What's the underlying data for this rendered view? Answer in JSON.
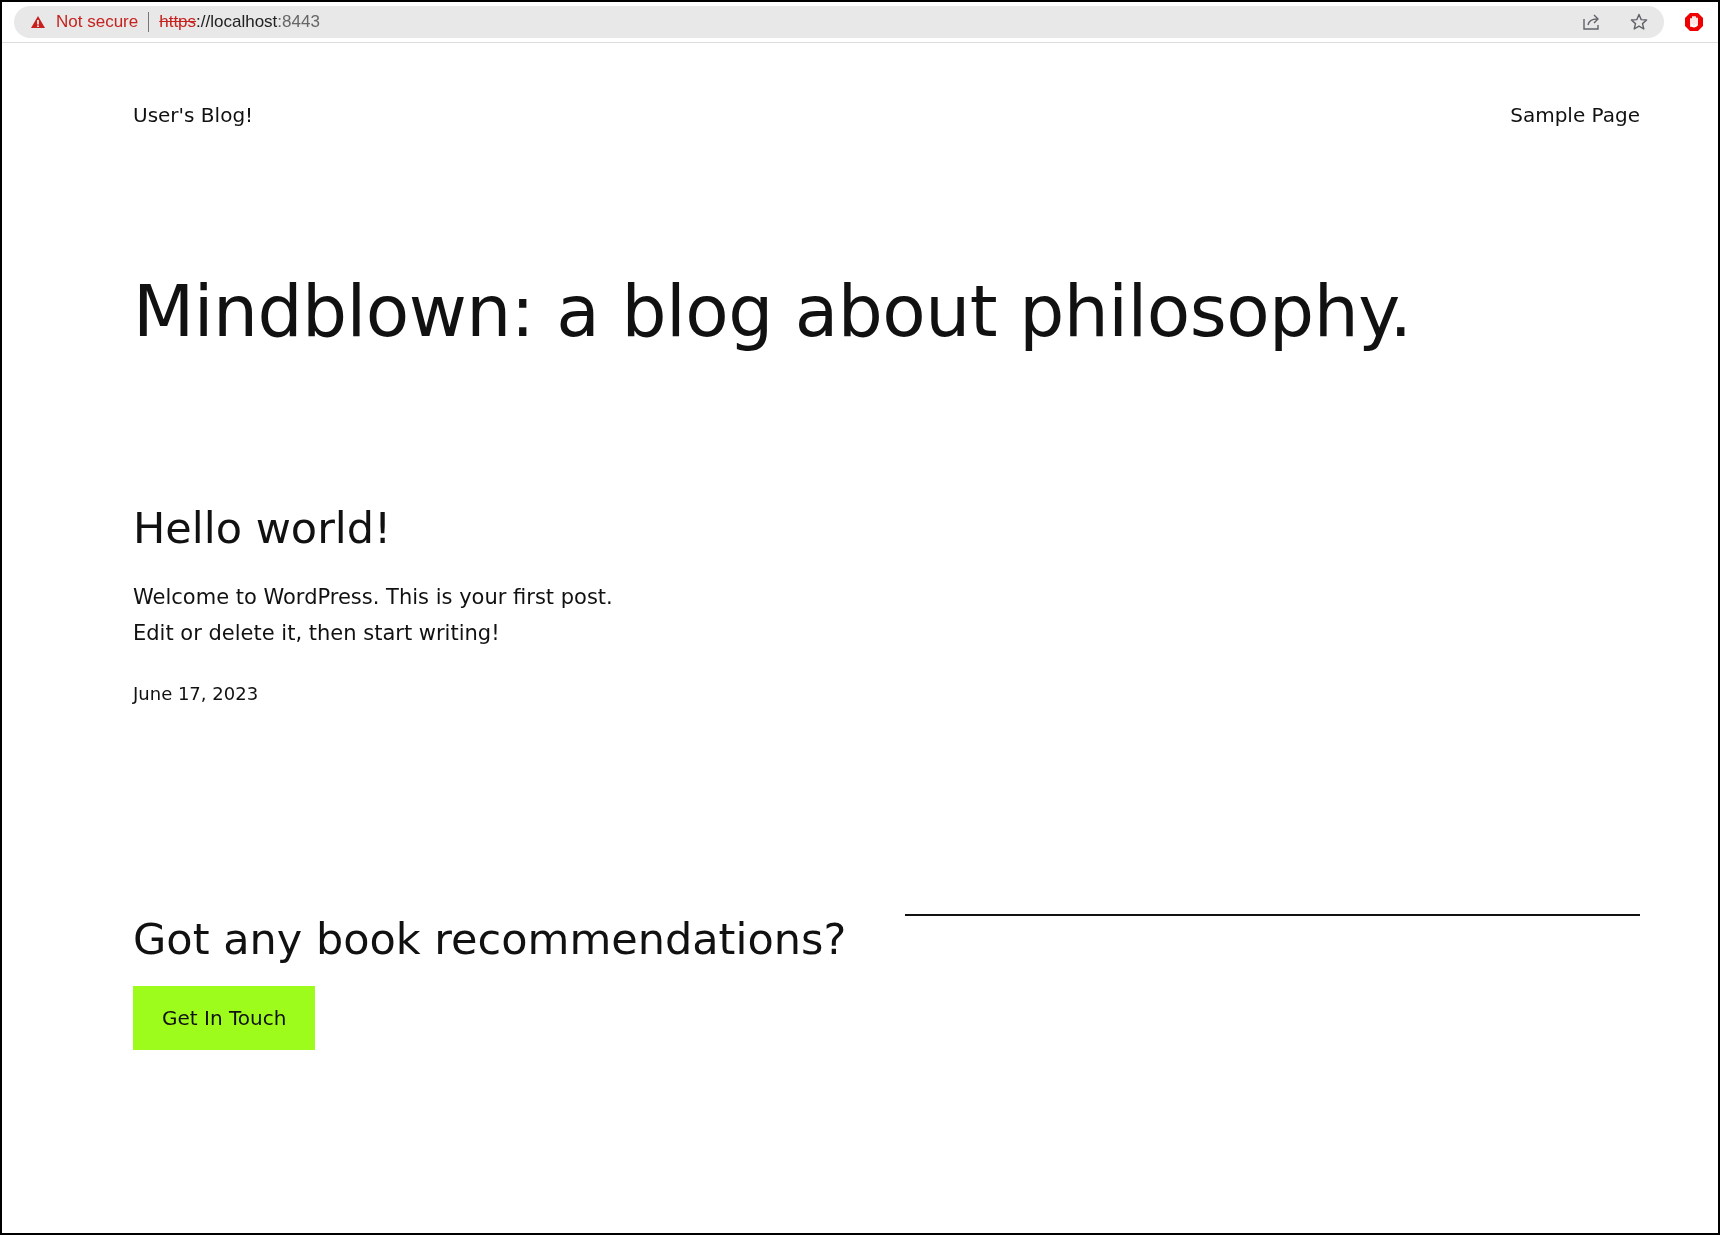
{
  "browser": {
    "security_label": "Not secure",
    "url": {
      "scheme": "https",
      "host": "://localhost",
      "port": ":8443"
    }
  },
  "header": {
    "site_title": "User's Blog!",
    "nav": [
      {
        "label": "Sample Page"
      }
    ]
  },
  "hero": {
    "heading": "Mindblown: a blog about philosophy."
  },
  "posts": [
    {
      "title": "Hello world!",
      "excerpt": [
        "Welcome to WordPress. This is your first post.",
        "Edit or delete it, then start writing!"
      ],
      "date": "June 17, 2023"
    }
  ],
  "footer_cta": {
    "heading": "Got any book recommendations?",
    "button": "Get In Touch"
  }
}
